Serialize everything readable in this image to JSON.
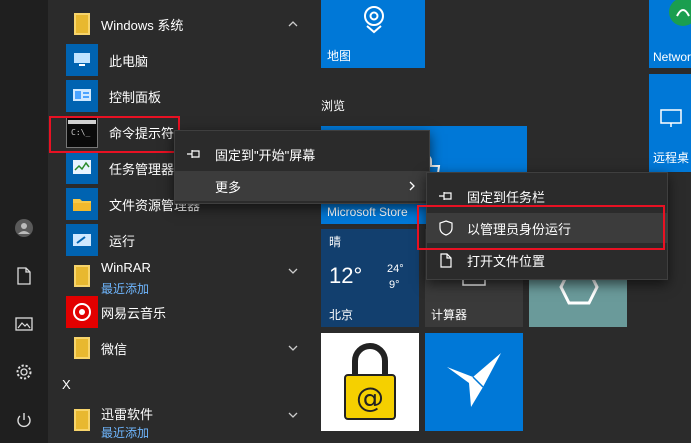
{
  "applist": {
    "group_windows": "Windows 系统",
    "items": [
      {
        "label": "此电脑"
      },
      {
        "label": "控制面板"
      },
      {
        "label": "命令提示符"
      },
      {
        "label": "任务管理器"
      },
      {
        "label": "文件资源管理器"
      },
      {
        "label": "运行"
      }
    ],
    "winrar": {
      "label": "WinRAR",
      "sub": "最近添加"
    },
    "netease": {
      "label": "网易云音乐"
    },
    "weixin": {
      "label": "微信"
    },
    "letter_x": "X",
    "xunlei": {
      "label": "迅雷软件",
      "sub": "最近添加"
    }
  },
  "tiles": {
    "maps": "地图",
    "network": "Network",
    "section_browse": "浏览",
    "remote": "远程桌",
    "store": "Microsoft Store",
    "weather": {
      "cond": "晴",
      "temp": "12°",
      "hi": "24°",
      "lo": "9°",
      "city": "北京"
    },
    "calc": "计算器"
  },
  "context_menu_1": {
    "items": [
      {
        "label": "固定到\"开始\"屏幕",
        "icon": "pin-icon"
      },
      {
        "label": "更多",
        "icon": "",
        "has_submenu": true
      }
    ]
  },
  "context_menu_2": {
    "items": [
      {
        "label": "固定到任务栏",
        "icon": "pin-icon"
      },
      {
        "label": "以管理员身份运行",
        "icon": "shield-icon"
      },
      {
        "label": "打开文件位置",
        "icon": "file-icon"
      }
    ]
  },
  "colors": {
    "accent": "#0078d7",
    "highlight_box": "#e81123",
    "menu_bg": "#2b2b2b"
  }
}
